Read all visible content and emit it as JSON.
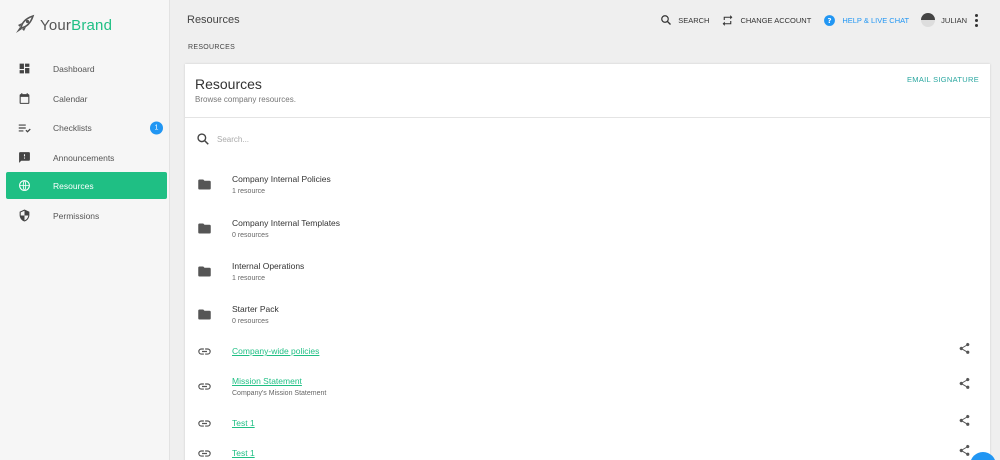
{
  "brand": {
    "part1": "Your",
    "part2": "Brand"
  },
  "sidebar": {
    "items": [
      {
        "label": "Dashboard",
        "icon": "dashboard-icon"
      },
      {
        "label": "Calendar",
        "icon": "calendar-icon"
      },
      {
        "label": "Checklists",
        "icon": "checklist-icon",
        "badge": "1"
      },
      {
        "label": "Announcements",
        "icon": "announcement-icon"
      },
      {
        "label": "Resources",
        "icon": "globe-icon",
        "active": true
      },
      {
        "label": "Permissions",
        "icon": "shield-icon"
      }
    ]
  },
  "topbar": {
    "title": "Resources",
    "search_label": "SEARCH",
    "change_account_label": "CHANGE ACCOUNT",
    "help_label": "HELP & LIVE CHAT",
    "user_label": "JULIAN"
  },
  "breadcrumb": "RESOURCES",
  "card": {
    "title": "Resources",
    "subtitle": "Browse company resources.",
    "email_signature": "EMAIL SIGNATURE",
    "search_placeholder": "Search..."
  },
  "folders": [
    {
      "name": "Company Internal Policies",
      "count": "1 resource"
    },
    {
      "name": "Company Internal Templates",
      "count": "0 resources"
    },
    {
      "name": "Internal Operations",
      "count": "1 resource"
    },
    {
      "name": "Starter Pack",
      "count": "0 resources"
    }
  ],
  "links": [
    {
      "name": "Company-wide policies",
      "desc": ""
    },
    {
      "name": "Mission Statement",
      "desc": "Company's Mission Statement"
    },
    {
      "name": "Test 1",
      "desc": ""
    },
    {
      "name": "Test 1",
      "desc": ""
    }
  ],
  "colors": {
    "accent": "#1fbf84",
    "help": "#2196f3",
    "badge": "#2196f3",
    "email_signature": "#2aa7a0"
  }
}
